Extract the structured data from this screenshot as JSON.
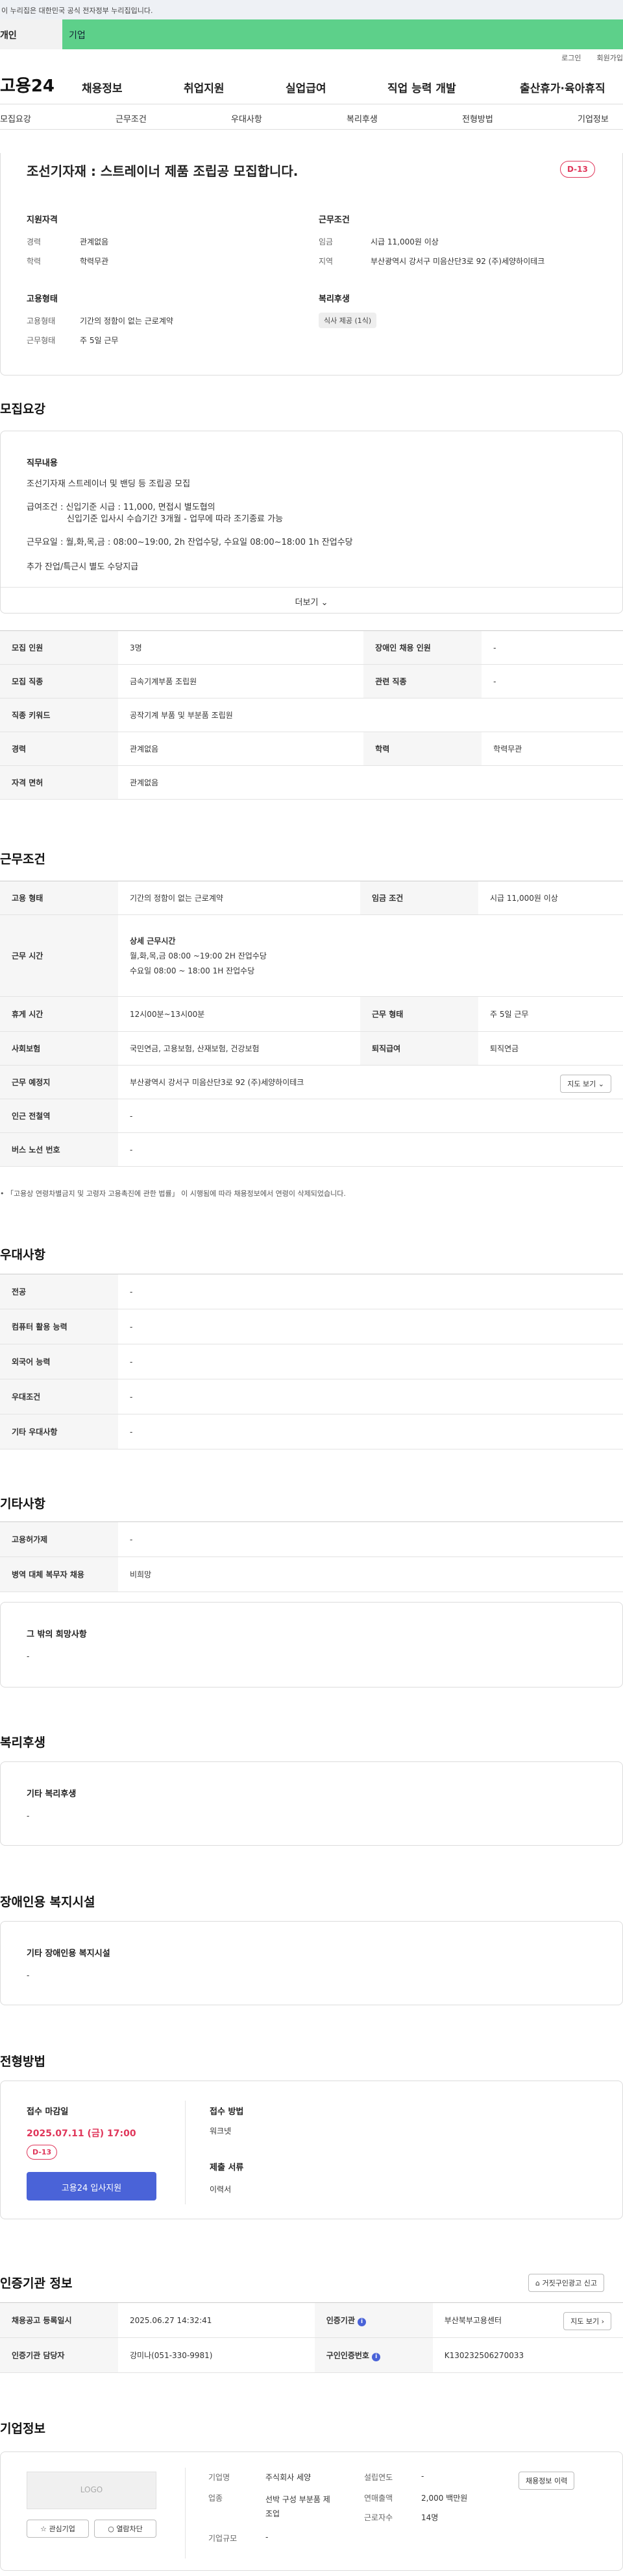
{
  "gov_banner": "이 누리집은 대한민국 공식 전자정부 누리집입니다.",
  "user_tabs": [
    "개인",
    "기업"
  ],
  "util": [
    "로그인",
    "회원가입"
  ],
  "logo": "고용24",
  "gnb": [
    "채용정보",
    "취업지원",
    "실업급여",
    "직업 능력 개발",
    "출산휴가·육아휴직"
  ],
  "lnb": [
    "모집요강",
    "근무조건",
    "우대사항",
    "복리후생",
    "전형방법",
    "기업정보"
  ],
  "summary": {
    "title": "조선기자재 : 스트레이너 제품 조립공 모집합니다.",
    "dday": "D-13",
    "qual_title": "지원자격",
    "qual": [
      [
        "경력",
        "관계없음"
      ],
      [
        "학력",
        "학력무관"
      ]
    ],
    "cond_title": "근무조건",
    "cond": [
      [
        "임금",
        "시급 11,000원 이상"
      ],
      [
        "지역",
        "부산광역시 강서구 미음산단3로 92 (주)세양하이테크"
      ]
    ],
    "emp_title": "고용형태",
    "emp": [
      [
        "고용형태",
        "기간의 정함이 없는 근로계약"
      ],
      [
        "근무형태",
        "주 5일 근무"
      ]
    ],
    "welfare_title": "복리후생",
    "welfare_chip": "식사 제공 (1식)"
  },
  "recruit": {
    "heading": "모집요강",
    "duty_title": "직무내용",
    "lines": [
      "조선기자재 스트레이너 및 밴딩 등 조립공 모집",
      "급여조건 : 신입기준 시급 : 11,000, 면접시 별도협의",
      "신입기준 입사시 수습기간 3개월 - 업무에 따라 조기종료 가능",
      "근무요일 : 월,화,목,금 : 08:00~19:00, 2h 잔업수당, 수요일 08:00~18:00 1h 잔업수당",
      "추가 잔업/특근시 별도 수당지급"
    ],
    "more": "더보기",
    "rows": [
      [
        "모집 인원",
        "3명",
        "장애인 채용 인원",
        "-"
      ],
      [
        "모집 직종",
        "금속기계부품 조립원",
        "관련 직종",
        "-"
      ],
      [
        "직종 키워드",
        "공작기계 부품 및 부분품 조립원"
      ],
      [
        "경력",
        "관계없음",
        "학력",
        "학력무관"
      ],
      [
        "자격 면허",
        "관계없음"
      ]
    ]
  },
  "work": {
    "heading": "근무조건",
    "emp_type": [
      "고용 형태",
      "기간의 정함이 없는 근로계약",
      "임금 조건",
      "시급 11,000원 이상"
    ],
    "hours_label": "근무 시간",
    "hours_title": "상세 근무시간",
    "hours_lines": [
      "월,화,목,금 08:00 ~19:00 2H 잔업수당",
      "수요일 08:00 ~ 18:00 1H 잔업수당"
    ],
    "rest": [
      "휴게 시간",
      "12시00분~13시00분",
      "근무 형태",
      "주 5일 근무"
    ],
    "ins": [
      "사회보험",
      "국민연금, 고용보험, 산재보험, 건강보험",
      "퇴직급여",
      "퇴직연금"
    ],
    "loc": [
      "근무 예정지",
      "부산광역시 강서구 미음산단3로 92 (주)세양하이테크"
    ],
    "map_btn": "지도 보기",
    "near": [
      "인근 전철역",
      "-"
    ],
    "bus": [
      "버스 노선 번호",
      "-"
    ],
    "note": "「고용상 연령차별금지 및 고령자 고용촉진에 관한 법률」 이 시행됨에 따라 채용정보에서 연령이 삭제되었습니다."
  },
  "pref": {
    "heading": "우대사항",
    "rows": [
      [
        "전공",
        "-"
      ],
      [
        "컴퓨터 활용 능력",
        "-"
      ],
      [
        "외국어 능력",
        "-"
      ],
      [
        "우대조건",
        "-"
      ],
      [
        "기타 우대사항",
        "-"
      ]
    ]
  },
  "etc": {
    "heading": "기타사항",
    "rows": [
      [
        "고용허가제",
        "-"
      ],
      [
        "병역 대체 복무자 채용",
        "비희망"
      ]
    ],
    "other_title": "그 밖의 희망사항",
    "other_val": "-"
  },
  "welfare": {
    "heading": "복리후생",
    "title": "기타 복리후생",
    "val": "-"
  },
  "disabled": {
    "heading": "장애인용 복지시설",
    "title": "기타 장애인용 복지시설",
    "val": "-"
  },
  "process": {
    "heading": "전형방법",
    "deadline_title": "접수 마감일",
    "deadline": "2025.07.11 (금) 17:00",
    "dday": "D-13",
    "apply_btn": "고용24 입사지원",
    "method_title": "접수 방법",
    "method": "워크넷",
    "docs_title": "제출 서류",
    "docs": "이력서"
  },
  "agency": {
    "heading": "인증기관 정보",
    "report_btn": "거짓구인광고 신고",
    "rows": [
      [
        "채용공고 등록일시",
        "2025.06.27 14:32:41",
        "인증기관",
        "부산북부고용센터"
      ],
      [
        "인증기관 담당자",
        "강미나(051-330-9981)",
        "구인인증번호",
        "K130232506270033"
      ]
    ],
    "map_btn": "지도 보기"
  },
  "company": {
    "heading": "기업정보",
    "logo": "LOGO",
    "fav": "관심기업",
    "block": "열람차단",
    "info_btn": "채용정보 이력",
    "left": [
      [
        "기업명",
        "주식회사 세양"
      ],
      [
        "업종",
        "선박 구성 부분품 제조업"
      ],
      [
        "기업규모",
        "-"
      ]
    ],
    "right": [
      [
        "설립연도",
        "-"
      ],
      [
        "연매출액",
        "2,000 백만원"
      ],
      [
        "근로자수",
        "14명"
      ]
    ]
  },
  "colors": {
    "accent": "#4a63d8",
    "dday": "#e0365a",
    "green": "#5dd08a"
  }
}
